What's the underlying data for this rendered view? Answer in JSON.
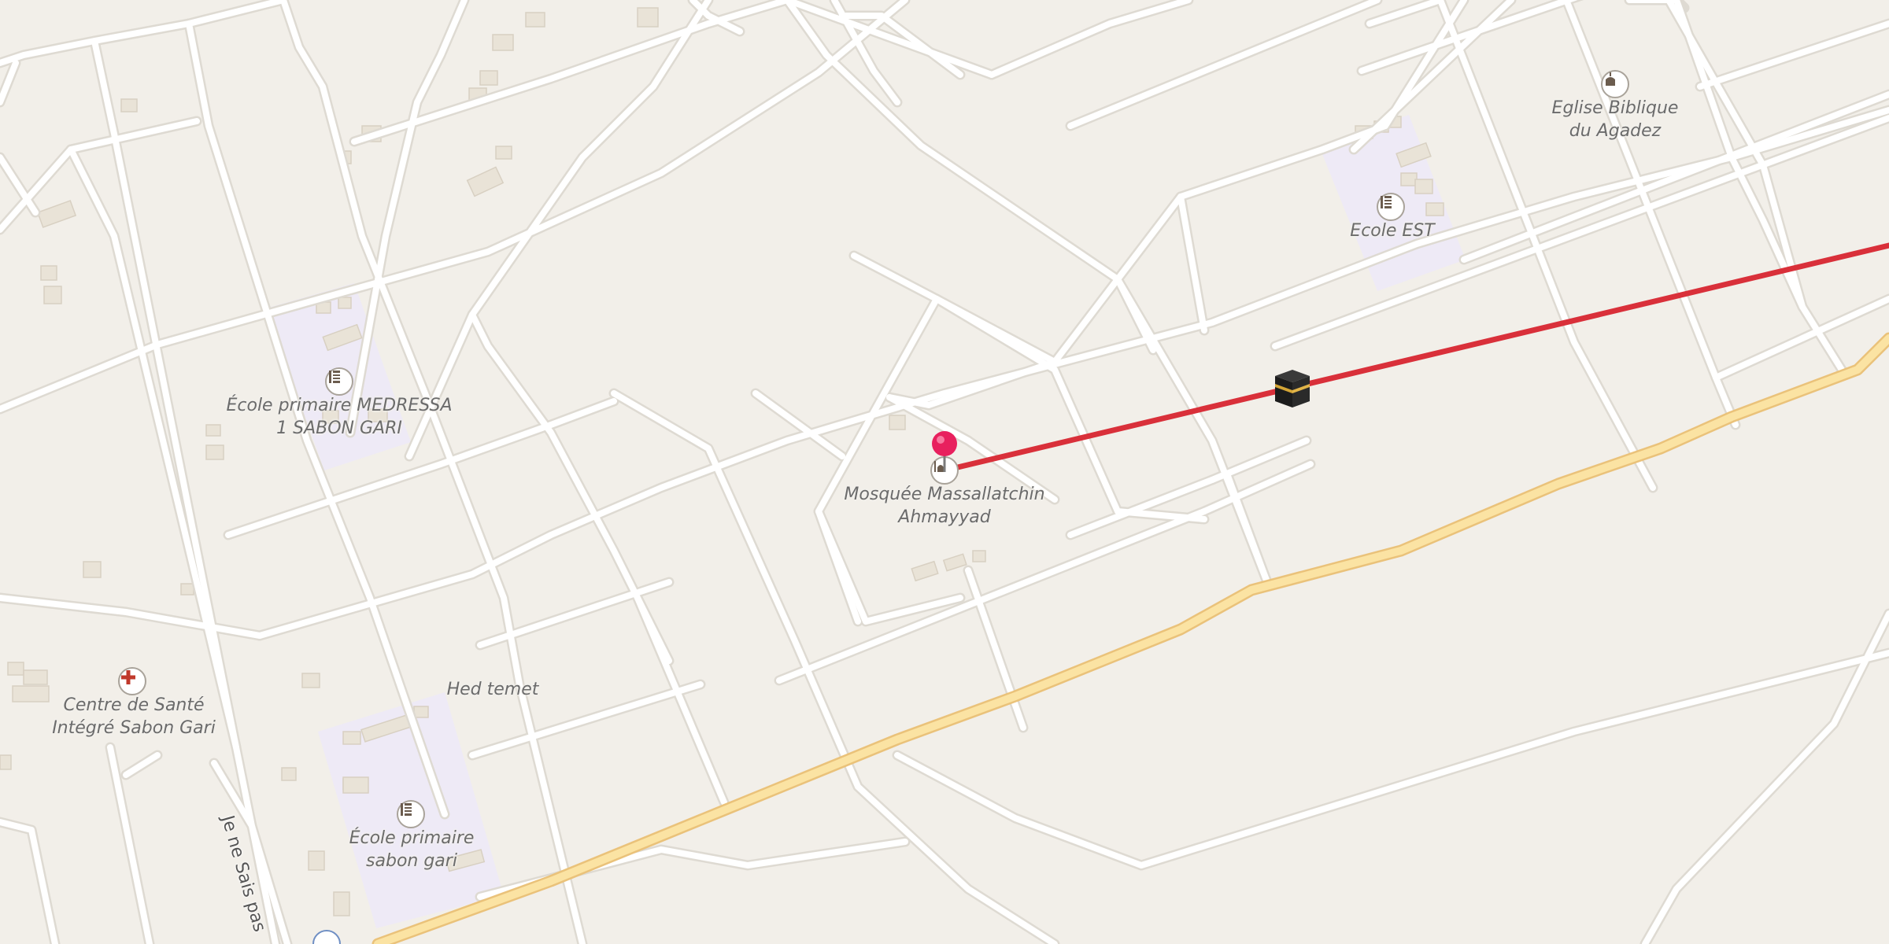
{
  "map": {
    "colors": {
      "background": "#f2efe9",
      "road": "#ffffff",
      "road_casing": "#dedad2",
      "main_road": "#fbe3a3",
      "main_road_casing": "#eac27a",
      "school_area": "#eeeaf6",
      "building": "#e9e3d7",
      "route": "#d9303a",
      "pin": "#e8205e"
    },
    "labels": {
      "ecole_medressa": [
        "École primaire MEDRESSA",
        "1 SABON GARI"
      ],
      "mosquee": [
        "Mosquée Massallatchin",
        "Ahmayyad"
      ],
      "ecole_est": [
        "Ecole EST"
      ],
      "eglise": [
        "Eglise Biblique",
        "du Agadez"
      ],
      "centre_sante": [
        "Centre de Santé",
        "Intégré Sabon Gari"
      ],
      "hed_temet": [
        "Hed temet"
      ],
      "ecole_sabon_gari": [
        "École primaire",
        "sabon gari"
      ]
    },
    "street_name": "Je ne Sais pas",
    "icons": {
      "school": "school-icon",
      "mosque": "mosque-icon",
      "church": "church-icon",
      "health": "health-cross-icon",
      "destination": "kaaba-icon",
      "pin": "location-pin-icon"
    }
  }
}
